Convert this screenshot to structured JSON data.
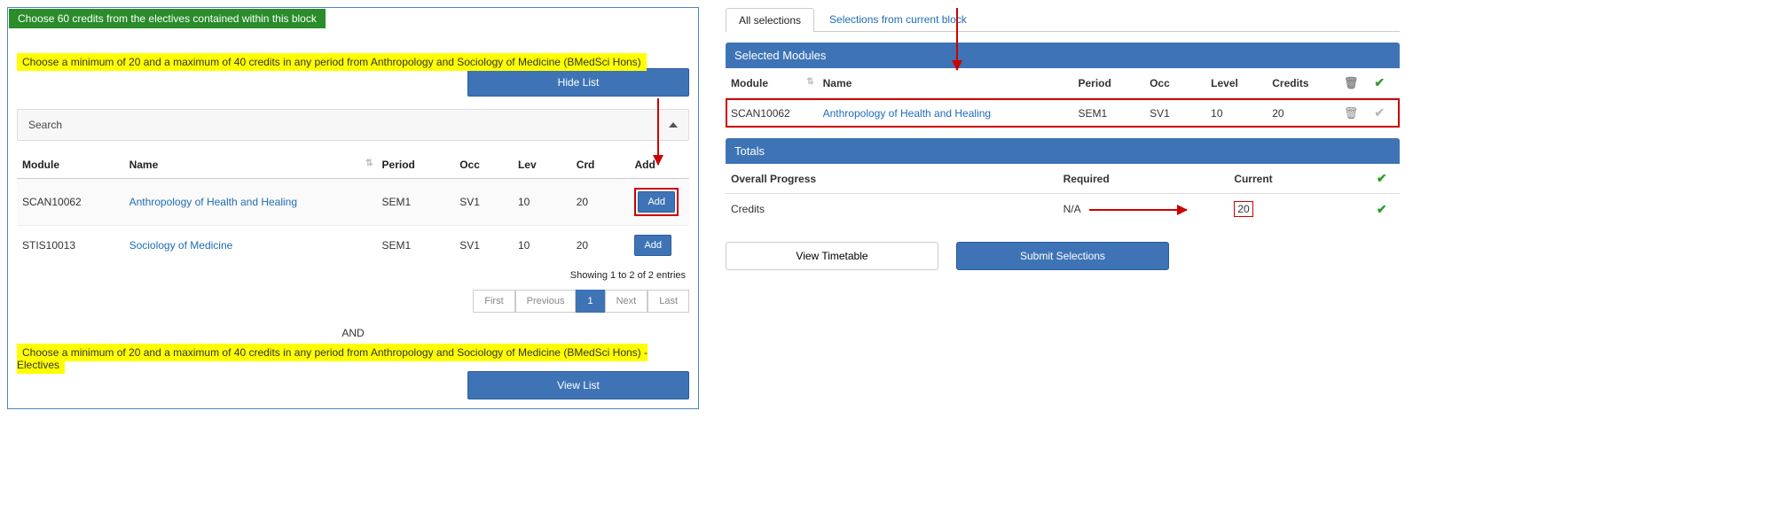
{
  "left": {
    "block_header": "Choose 60 credits from the electives contained within this block",
    "rule1": "Choose a minimum of 20 and a maximum of 40 credits in any period from Anthropology and Sociology of Medicine (BMedSci Hons)",
    "hide_list_btn": "Hide List",
    "search_label": "Search",
    "table_headers": {
      "module": "Module",
      "name": "Name",
      "period": "Period",
      "occ": "Occ",
      "lev": "Lev",
      "crd": "Crd",
      "add": "Add"
    },
    "rows": [
      {
        "module": "SCAN10062",
        "name": "Anthropology of Health and Healing",
        "period": "SEM1",
        "occ": "SV1",
        "lev": "10",
        "crd": "20",
        "add": "Add"
      },
      {
        "module": "STIS10013",
        "name": "Sociology of Medicine",
        "period": "SEM1",
        "occ": "SV1",
        "lev": "10",
        "crd": "20",
        "add": "Add"
      }
    ],
    "entries_info": "Showing 1 to 2 of 2 entries",
    "paginator": {
      "first": "First",
      "prev": "Previous",
      "page": "1",
      "next": "Next",
      "last": "Last"
    },
    "and": "AND",
    "rule2": "Choose a minimum of 20 and a maximum of 40 credits in any period from Anthropology and Sociology of Medicine (BMedSci Hons) - Electives",
    "view_list_btn": "View List"
  },
  "right": {
    "tabs": {
      "all": "All selections",
      "current": "Selections from current block"
    },
    "selected_header": "Selected Modules",
    "sel_headers": {
      "module": "Module",
      "name": "Name",
      "period": "Period",
      "occ": "Occ",
      "level": "Level",
      "credits": "Credits"
    },
    "sel_rows": [
      {
        "module": "SCAN10062",
        "name": "Anthropology of Health and Healing",
        "period": "SEM1",
        "occ": "SV1",
        "level": "10",
        "credits": "20"
      }
    ],
    "totals_header": "Totals",
    "overall_progress": "Overall Progress",
    "required": "Required",
    "current": "Current",
    "credits_label": "Credits",
    "required_val": "N/A",
    "current_val": "20",
    "view_timetable": "View Timetable",
    "submit": "Submit Selections"
  }
}
